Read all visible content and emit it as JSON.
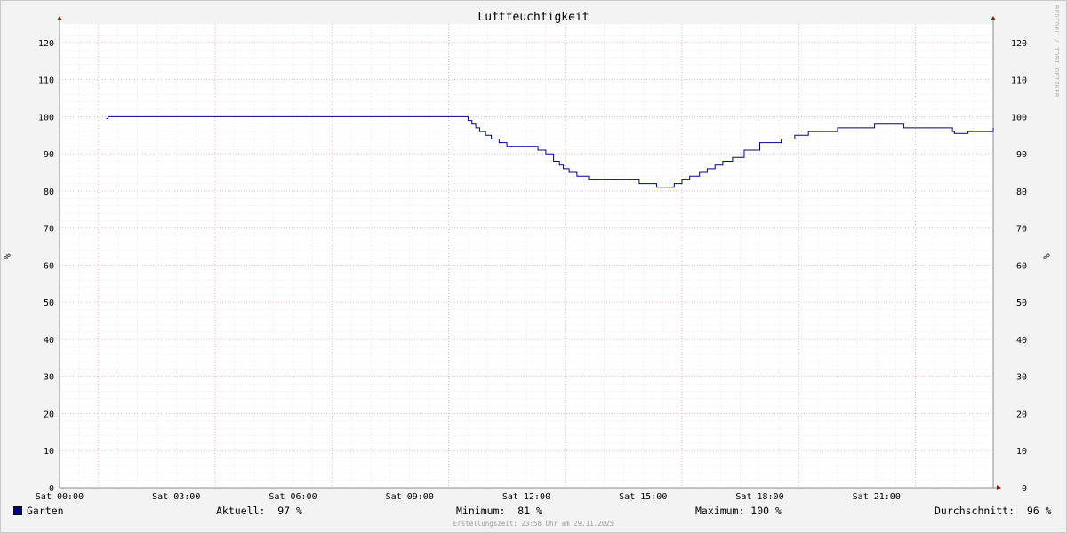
{
  "chart_data": {
    "type": "line",
    "title": "Luftfeuchtigkeit",
    "ylabel": "%",
    "ylim": [
      0,
      125
    ],
    "xlim": [
      0,
      24
    ],
    "y_ticks": [
      0,
      10,
      20,
      30,
      40,
      50,
      60,
      70,
      80,
      90,
      100,
      110,
      120
    ],
    "x_ticks": [
      {
        "value": 0,
        "label": "Sat 00:00"
      },
      {
        "value": 3,
        "label": "Sat 03:00"
      },
      {
        "value": 6,
        "label": "Sat 06:00"
      },
      {
        "value": 9,
        "label": "Sat 09:00"
      },
      {
        "value": 12,
        "label": "Sat 12:00"
      },
      {
        "value": 15,
        "label": "Sat 15:00"
      },
      {
        "value": 18,
        "label": "Sat 18:00"
      },
      {
        "value": 21,
        "label": "Sat 21:00"
      }
    ],
    "grid": true,
    "series": [
      {
        "name": "Garten",
        "color": "#00008b",
        "x": [
          1.2,
          1.25,
          10.4,
          10.5,
          10.6,
          10.7,
          10.8,
          10.95,
          11.1,
          11.3,
          11.5,
          12.3,
          12.5,
          12.7,
          12.85,
          12.95,
          13.1,
          13.3,
          13.45,
          13.6,
          14.8,
          14.9,
          15.1,
          15.35,
          15.6,
          15.8,
          16.0,
          16.2,
          16.45,
          16.65,
          16.85,
          17.05,
          17.3,
          17.6,
          18.0,
          18.55,
          18.9,
          19.25,
          19.35,
          20.0,
          20.3,
          20.95,
          21.3,
          21.7,
          22.7,
          22.95,
          23.0,
          23.35,
          24.0
        ],
        "y": [
          99.5,
          100,
          100,
          99,
          98,
          97,
          96,
          95,
          94,
          93,
          92,
          91,
          90,
          88,
          87,
          86,
          85,
          84,
          84,
          83,
          83,
          82,
          82,
          81,
          81,
          82,
          83,
          84,
          85,
          86,
          87,
          88,
          89,
          91,
          93,
          94,
          95,
          96,
          96,
          97,
          97,
          98,
          98,
          97,
          97,
          96,
          95.5,
          96,
          97
        ]
      }
    ]
  },
  "legend": {
    "series_name": "Garten",
    "aktuell": "Aktuell:  97 %",
    "minimum": "Minimum:  81 %",
    "maximum": "Maximum: 100 %",
    "durchschnitt": "Durchschnitt:  96 %"
  },
  "footer": "Erstellungszeit: 23:58 Uhr am 29.11.2025",
  "watermark": "RRDTOOL / TOBI OETIKER"
}
